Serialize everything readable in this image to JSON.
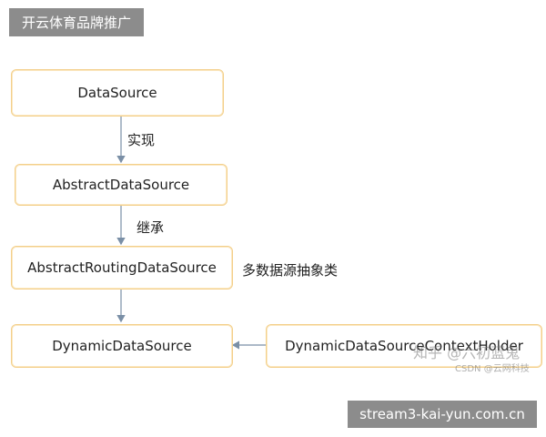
{
  "banner": {
    "text": "开云体育品牌推广"
  },
  "nodes": {
    "datasource": "DataSource",
    "abstract_datasource": "AbstractDataSource",
    "abstract_routing": "AbstractRoutingDataSource",
    "dynamic": "DynamicDataSource",
    "context_holder": "DynamicDataSourceContextHolder"
  },
  "edges": {
    "implements": "实现",
    "inherits": "继承"
  },
  "annotation": "多数据源抽象类",
  "watermark": {
    "main": "知乎 @六初蓝鬼",
    "sub": "CSDN @云网科技"
  },
  "footer": {
    "text": "stream3-kai-yun.com.cn"
  },
  "colors": {
    "box_border": "#f3cf8a",
    "arrow": "#7a8fa6",
    "banner_bg": "#8c8c8c"
  }
}
